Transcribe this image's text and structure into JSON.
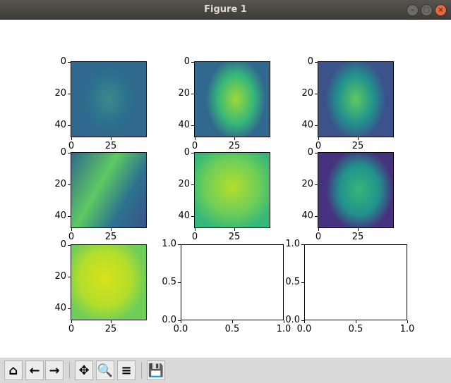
{
  "window": {
    "title": "Figure 1"
  },
  "toolbar": {
    "buttons": [
      {
        "name": "home",
        "icon": "⌂"
      },
      {
        "name": "back",
        "icon": "←"
      },
      {
        "name": "forward",
        "icon": "→"
      },
      {
        "name": "pan",
        "icon": "✥"
      },
      {
        "name": "zoom",
        "icon": "🔍"
      },
      {
        "name": "configure",
        "icon": "≡"
      },
      {
        "name": "save",
        "icon": "💾"
      }
    ]
  },
  "colors": {
    "viridis_dark": "#440154",
    "viridis_mid": "#21918c",
    "viridis_light": "#fde725"
  },
  "panels": [
    {
      "type": "image",
      "yticks": [
        "0",
        "20",
        "40"
      ],
      "xticks": [
        "0",
        "25"
      ]
    },
    {
      "type": "image",
      "yticks": [
        "0",
        "20",
        "40"
      ],
      "xticks": [
        "0",
        "25"
      ]
    },
    {
      "type": "image",
      "yticks": [
        "0",
        "20",
        "40"
      ],
      "xticks": [
        "0",
        "25"
      ]
    },
    {
      "type": "image",
      "yticks": [
        "0",
        "20",
        "40"
      ],
      "xticks": [
        "0",
        "25"
      ]
    },
    {
      "type": "image",
      "yticks": [
        "0",
        "20",
        "40"
      ],
      "xticks": [
        "0",
        "25"
      ]
    },
    {
      "type": "image",
      "yticks": [
        "0",
        "20",
        "40"
      ],
      "xticks": [
        "0",
        "25"
      ]
    },
    {
      "type": "image",
      "yticks": [
        "0",
        "20",
        "40"
      ],
      "xticks": [
        "0",
        "25"
      ]
    },
    {
      "type": "empty",
      "yticks": [
        "0.0",
        "0.5",
        "1.0"
      ],
      "xticks": [
        "0.0",
        "0.5",
        "1.0"
      ]
    },
    {
      "type": "empty",
      "yticks": [
        "0.0",
        "0.5",
        "1.0"
      ],
      "xticks": [
        "0.0",
        "0.5",
        "1.0"
      ]
    }
  ]
}
